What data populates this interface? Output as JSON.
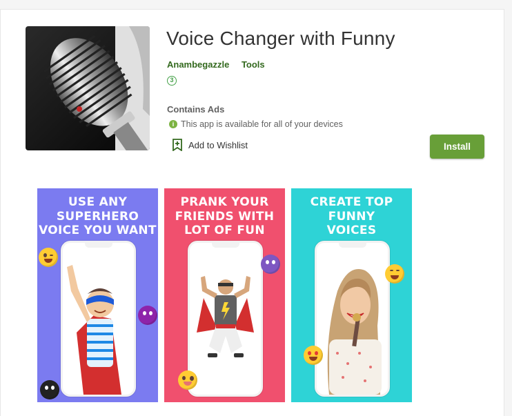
{
  "app": {
    "title": "Voice Changer with Funny",
    "developer": "Anambegazzle",
    "category": "Tools",
    "content_rating": "3",
    "contains_ads": "Contains Ads",
    "availability": "This app is available for all of your devices",
    "wishlist_label": "Add to Wishlist",
    "install_label": "Install"
  },
  "colors": {
    "install": "#689f38",
    "meta_link": "#33691e",
    "shot1_bg": "#7b7bf0",
    "shot2_bg": "#f0506e",
    "shot3_bg": "#2ed3d6"
  },
  "screenshots": [
    {
      "caption": [
        "USE ANY",
        "SUPERHERO",
        "VOICE YOU WANT"
      ]
    },
    {
      "caption": [
        "PRANK YOUR",
        "FRIENDS WITH",
        "LOT OF FUN"
      ]
    },
    {
      "caption": [
        "CREATE TOP",
        "FUNNY",
        "VOICES"
      ]
    }
  ]
}
